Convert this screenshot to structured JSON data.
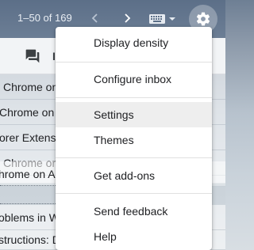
{
  "toolbar": {
    "count_text": "1–50 of 169",
    "prev_icon": "chevron-left-icon",
    "next_icon": "chevron-right-icon",
    "keyboard_icon": "keyboard-icon",
    "settings_icon": "gear-icon"
  },
  "subbar": {
    "chat_icon": "chat-icon",
    "glyph": "I"
  },
  "rows": [
    {
      "text": "Chrome on"
    },
    {
      "text": "Chrome on"
    },
    {
      "text": "orer Extens"
    },
    {
      "text": "Chrome or"
    },
    {
      "text": "hrome on A"
    },
    {
      "text": "oblems in W"
    },
    {
      "text": "structions: D"
    }
  ],
  "menu": {
    "items": [
      {
        "label": "Display density"
      },
      {
        "label": "Configure inbox"
      },
      {
        "label": "Settings"
      },
      {
        "label": "Themes"
      },
      {
        "label": "Get add-ons"
      },
      {
        "label": "Send feedback"
      },
      {
        "label": "Help"
      }
    ]
  },
  "colors": {
    "toolbar_bg": "#5c6f88",
    "menu_bg": "#ffffff",
    "menu_hover": "#eeeeee",
    "text": "#202124"
  }
}
